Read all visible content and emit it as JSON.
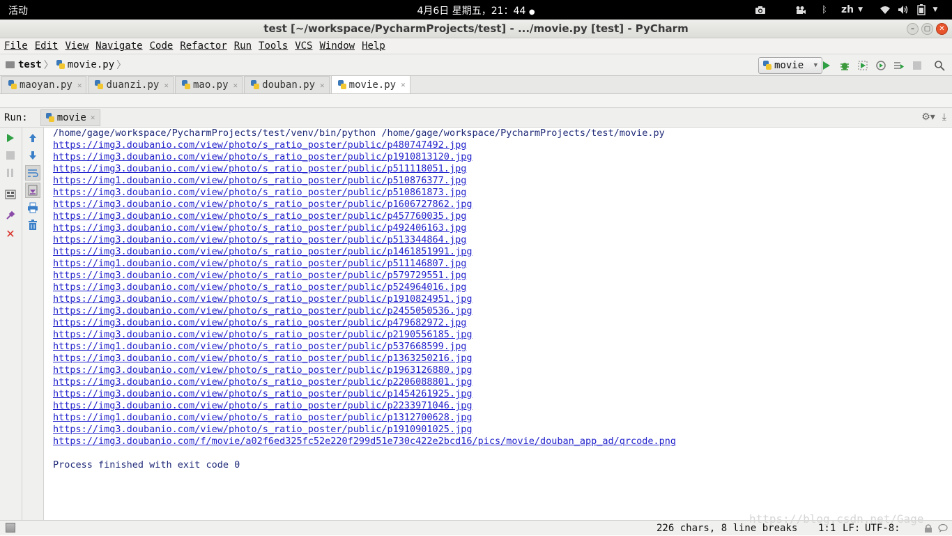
{
  "system_bar": {
    "activities": "活动",
    "clock": "4月6日 星期五，21：44",
    "language": "zh"
  },
  "window": {
    "title": "test [~/workspace/PycharmProjects/test] - .../movie.py [test] - PyCharm"
  },
  "menu": {
    "items": [
      "File",
      "Edit",
      "View",
      "Navigate",
      "Code",
      "Refactor",
      "Run",
      "Tools",
      "VCS",
      "Window",
      "Help"
    ]
  },
  "breadcrumb": {
    "project": "test",
    "file": "movie.py"
  },
  "run_config": {
    "selected": "movie"
  },
  "editor_tabs": [
    {
      "label": "maoyan.py",
      "active": false
    },
    {
      "label": "duanzi.py",
      "active": false
    },
    {
      "label": "mao.py",
      "active": false
    },
    {
      "label": "douban.py",
      "active": false
    },
    {
      "label": "movie.py",
      "active": true
    }
  ],
  "run_panel": {
    "label": "Run:",
    "tab": "movie"
  },
  "console": {
    "command": "/home/gage/workspace/PycharmProjects/test/venv/bin/python /home/gage/workspace/PycharmProjects/test/movie.py",
    "links": [
      "https://img3.doubanio.com/view/photo/s_ratio_poster/public/p480747492.jpg",
      "https://img3.doubanio.com/view/photo/s_ratio_poster/public/p1910813120.jpg",
      "https://img3.doubanio.com/view/photo/s_ratio_poster/public/p511118051.jpg",
      "https://img1.doubanio.com/view/photo/s_ratio_poster/public/p510876377.jpg",
      "https://img3.doubanio.com/view/photo/s_ratio_poster/public/p510861873.jpg",
      "https://img3.doubanio.com/view/photo/s_ratio_poster/public/p1606727862.jpg",
      "https://img3.doubanio.com/view/photo/s_ratio_poster/public/p457760035.jpg",
      "https://img3.doubanio.com/view/photo/s_ratio_poster/public/p492406163.jpg",
      "https://img3.doubanio.com/view/photo/s_ratio_poster/public/p513344864.jpg",
      "https://img3.doubanio.com/view/photo/s_ratio_poster/public/p1461851991.jpg",
      "https://img1.doubanio.com/view/photo/s_ratio_poster/public/p511146807.jpg",
      "https://img3.doubanio.com/view/photo/s_ratio_poster/public/p579729551.jpg",
      "https://img3.doubanio.com/view/photo/s_ratio_poster/public/p524964016.jpg",
      "https://img3.doubanio.com/view/photo/s_ratio_poster/public/p1910824951.jpg",
      "https://img3.doubanio.com/view/photo/s_ratio_poster/public/p2455050536.jpg",
      "https://img3.doubanio.com/view/photo/s_ratio_poster/public/p479682972.jpg",
      "https://img3.doubanio.com/view/photo/s_ratio_poster/public/p2190556185.jpg",
      "https://img1.doubanio.com/view/photo/s_ratio_poster/public/p537668599.jpg",
      "https://img3.doubanio.com/view/photo/s_ratio_poster/public/p1363250216.jpg",
      "https://img3.doubanio.com/view/photo/s_ratio_poster/public/p1963126880.jpg",
      "https://img3.doubanio.com/view/photo/s_ratio_poster/public/p2206088801.jpg",
      "https://img3.doubanio.com/view/photo/s_ratio_poster/public/p1454261925.jpg",
      "https://img3.doubanio.com/view/photo/s_ratio_poster/public/p2233971046.jpg",
      "https://img1.doubanio.com/view/photo/s_ratio_poster/public/p1312700628.jpg",
      "https://img3.doubanio.com/view/photo/s_ratio_poster/public/p1910901025.jpg",
      "https://img3.doubanio.com/f/movie/a02f6ed325fc52e220f299d51e730c422e2bcd16/pics/movie/douban_app_ad/qrcode.png"
    ],
    "finished": "Process finished with exit code 0"
  },
  "status_bar": {
    "chars": "226 chars, 8 line breaks",
    "position": "1:1",
    "line_separator": "LF:",
    "encoding": "UTF-8:",
    "watermark": "https://blog.csdn.net/Gage"
  },
  "colors": {
    "link": "#2222cc",
    "console_text": "#1f2a78",
    "run_green": "#2ea043",
    "stop_red": "#d9342b",
    "close_orange": "#e8542c"
  }
}
